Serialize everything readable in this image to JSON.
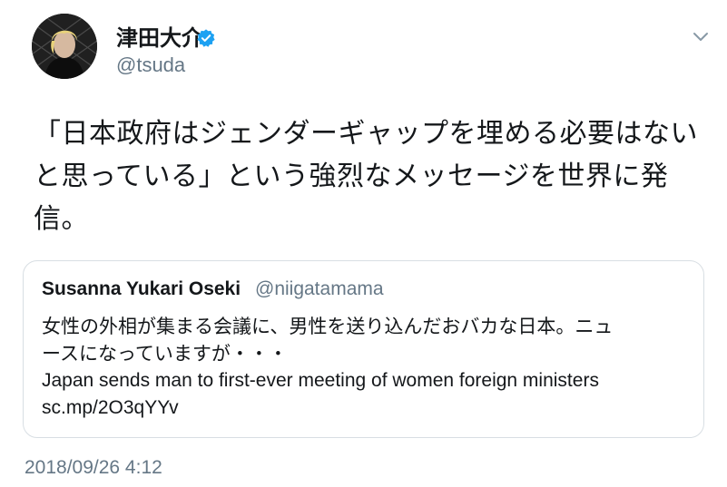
{
  "author": {
    "display_name": "津田大介",
    "handle": "@tsuda",
    "verified": true,
    "verified_icon": "verified-badge-icon",
    "verified_color": "#1da1f2"
  },
  "menu_icon": "chevron-down-icon",
  "tweet": {
    "lines": [
      "「日本政府はジェンダーギャップを埋める必要はない",
      "と思っている」という強烈なメッセージを世界に発",
      "信。"
    ]
  },
  "quoted_tweet": {
    "display_name": "Susanna Yukari Oseki",
    "handle": "@niigatamama",
    "lines": [
      "女性の外相が集まる会議に、男性を送り込んだおバカな日本。ニュ",
      "ースになっていますが・・・",
      "Japan sends man to first-ever meeting of women foreign ministers",
      "sc.mp/2O3qYYv"
    ]
  },
  "timestamp": "2018/09/26 4:12",
  "colors": {
    "text": "#14171a",
    "secondary": "#657786",
    "border": "#d8dee3"
  }
}
